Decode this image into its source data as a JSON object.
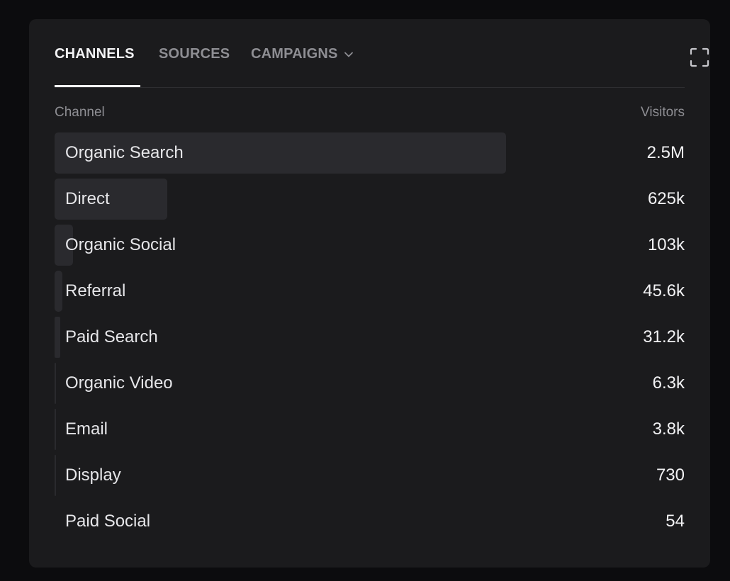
{
  "tabs": {
    "channels": "CHANNELS",
    "sources": "SOURCES",
    "campaigns": "CAMPAIGNS"
  },
  "icons": {
    "expand": "expand-icon",
    "campaigns_dropdown": "chevron-down-icon"
  },
  "table": {
    "header_channel": "Channel",
    "header_visitors": "Visitors",
    "rows": [
      {
        "label": "Organic Search",
        "value": "2.5M",
        "share": 1.0
      },
      {
        "label": "Direct",
        "value": "625k",
        "share": 0.25
      },
      {
        "label": "Organic Social",
        "value": "103k",
        "share": 0.041
      },
      {
        "label": "Referral",
        "value": "45.6k",
        "share": 0.018
      },
      {
        "label": "Paid Search",
        "value": "31.2k",
        "share": 0.0125
      },
      {
        "label": "Organic Video",
        "value": "6.3k",
        "share": 0.0025
      },
      {
        "label": "Email",
        "value": "3.8k",
        "share": 0.0015
      },
      {
        "label": "Display",
        "value": "730",
        "share": 0.0003
      },
      {
        "label": "Paid Social",
        "value": "54",
        "share": 2e-05
      }
    ]
  },
  "colors": {
    "card_background": "#1b1b1d",
    "bar_fill": "#2a2a2e",
    "active_tab": "#f2f2f4",
    "inactive_tab": "#8e8e93"
  }
}
